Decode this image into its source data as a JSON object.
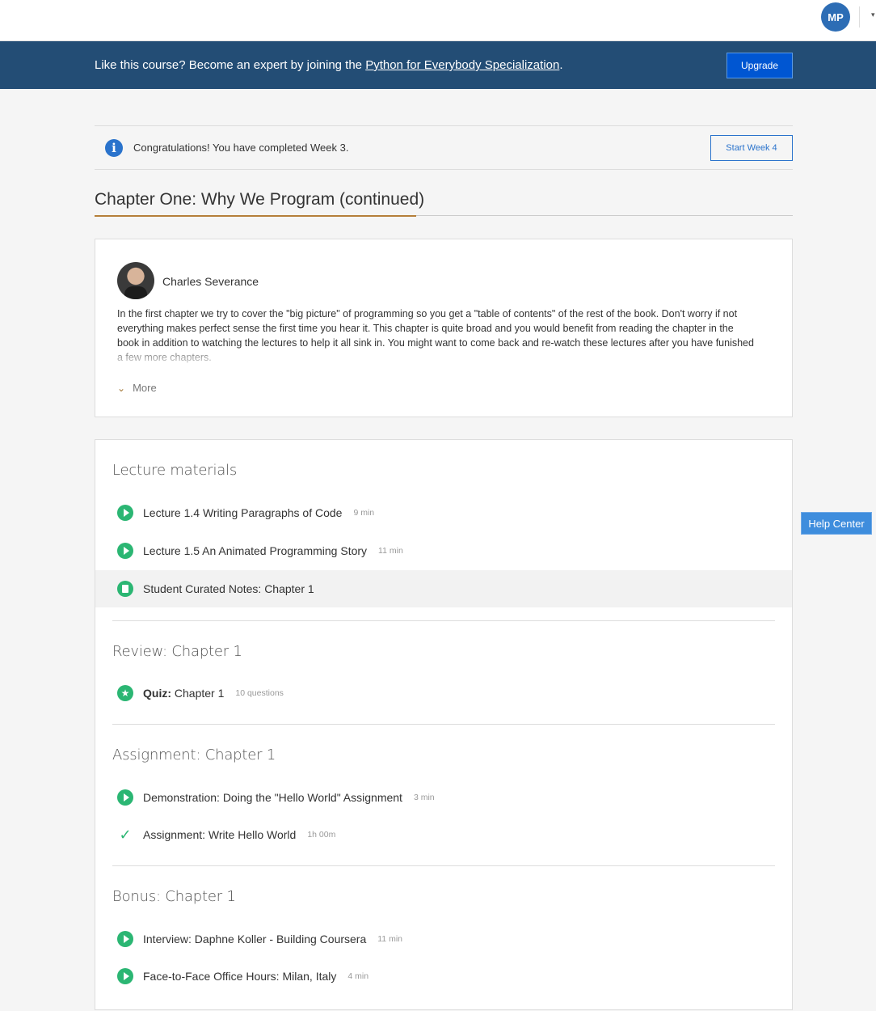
{
  "topbar": {
    "avatar_initials": "MP"
  },
  "banner": {
    "message_prefix": "Like this course? Become an expert by joining the ",
    "link_text": "Python for Everybody Specialization",
    "message_suffix": ".",
    "upgrade_label": "Upgrade"
  },
  "congrats": {
    "message": "Congratulations! You have completed Week 3.",
    "button_label": "Start Week 4"
  },
  "chapter": {
    "title": "Chapter One: Why We Program (continued)",
    "author": "Charles Severance",
    "description": "In the first chapter we try to cover the \"big picture\" of programming so you get a \"table of contents\" of the rest of the book. Don't worry if not everything makes perfect sense the first time you hear it. This chapter is quite broad and you would benefit from reading the chapter in the book in addition to watching the lectures to help it all sink in. You might want to come back and re-watch these lectures after you have funished a few more chapters.",
    "more_label": "More"
  },
  "sections": [
    {
      "title": "Lecture materials",
      "items": [
        {
          "label": "Lecture 1.4 Writing Paragraphs of Code",
          "meta": "9 min",
          "icon": "play-icon"
        },
        {
          "label": "Lecture 1.5 An Animated Programming Story",
          "meta": "11 min",
          "icon": "play-icon"
        },
        {
          "label": "Student Curated Notes: Chapter 1",
          "meta": "",
          "icon": "document-icon"
        }
      ]
    },
    {
      "title": "Review: Chapter 1",
      "items": [
        {
          "prefix": "Quiz:",
          "label": " Chapter 1",
          "meta": "10 questions",
          "icon": "star-icon"
        }
      ]
    },
    {
      "title": "Assignment: Chapter 1",
      "items": [
        {
          "label": "Demonstration: Doing the \"Hello World\" Assignment",
          "meta": "3 min",
          "icon": "play-icon"
        },
        {
          "label": "Assignment: Write Hello World",
          "meta": "1h 00m",
          "icon": "checkmark-icon"
        }
      ]
    },
    {
      "title": "Bonus: Chapter 1",
      "items": [
        {
          "label": "Interview: Daphne Koller - Building Coursera",
          "meta": "11 min",
          "icon": "play-icon"
        },
        {
          "label": "Face-to-Face Office Hours: Milan, Italy",
          "meta": "4 min",
          "icon": "play-icon"
        }
      ]
    }
  ],
  "help": {
    "label": "Help Center"
  }
}
